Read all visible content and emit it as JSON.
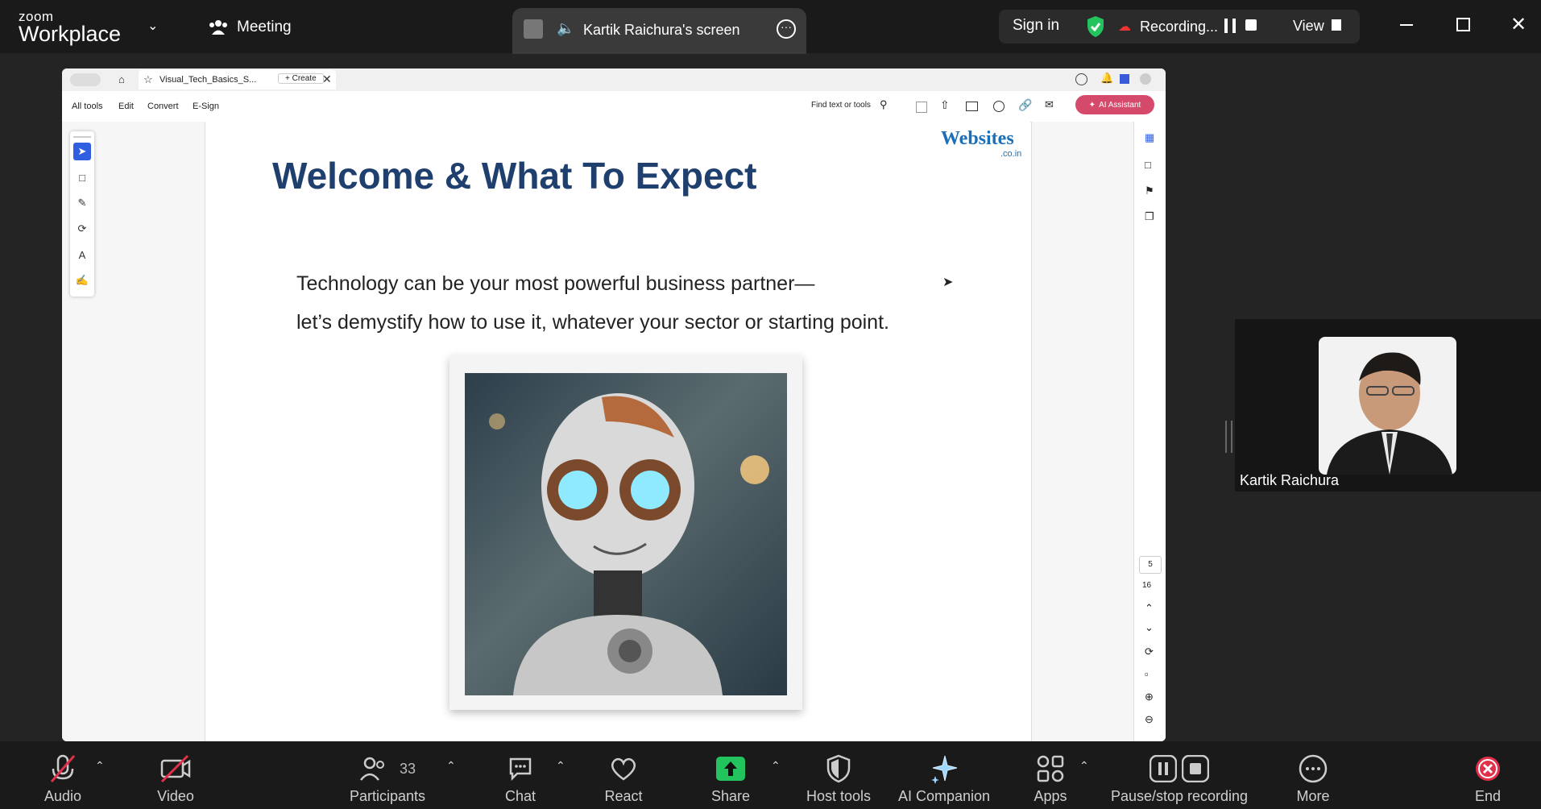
{
  "app": {
    "brand_small": "zoom",
    "brand_big": "Workplace"
  },
  "topbar": {
    "meeting_label": "Meeting",
    "share_label": "Kartik Raichura's screen",
    "sign_in": "Sign in",
    "recording": "Recording...",
    "view": "View"
  },
  "viewer": {
    "tab_name": "Visual_Tech_Basics_S...",
    "create_label": "Create",
    "menu": [
      "All tools",
      "Edit",
      "Convert",
      "E-Sign"
    ],
    "find_placeholder": "Find text or tools",
    "ai_assistant": "AI Assistant",
    "page_current": "5",
    "page_total": "16"
  },
  "slide": {
    "logo_main": "Websites",
    "logo_sub": ".co.in",
    "title": "Welcome & What To Expect",
    "line1": "Technology can be your most powerful business partner—",
    "line2": "let’s demystify how to use it, whatever your sector or starting point."
  },
  "participant_tile": {
    "name": "Kartik Raichura"
  },
  "bottombar": {
    "audio": "Audio",
    "video": "Video",
    "participants": "Participants",
    "participants_count": "33",
    "chat": "Chat",
    "react": "React",
    "share": "Share",
    "host_tools": "Host tools",
    "ai_companion": "AI Companion",
    "apps": "Apps",
    "pause_stop": "Pause/stop recording",
    "more": "More",
    "end": "End"
  },
  "colors": {
    "title_blue": "#1f3f6e",
    "share_green": "#23c45e",
    "ai_button": "#d54a6a",
    "end_red": "#e0304a"
  }
}
